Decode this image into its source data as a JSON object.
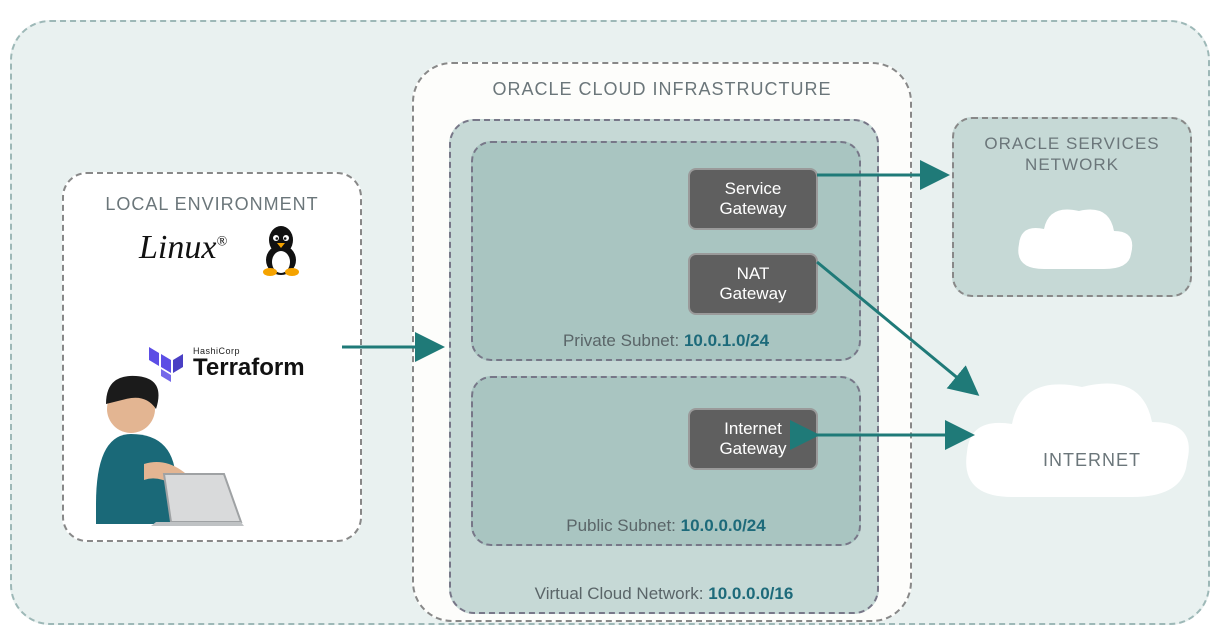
{
  "outer": {
    "title": ""
  },
  "local": {
    "title": "LOCAL ENVIRONMENT",
    "linux_label": "Linux",
    "linux_reg": "®",
    "terraform_vendor": "HashiCorp",
    "terraform_name": "Terraform"
  },
  "oci": {
    "title": "ORACLE CLOUD INFRASTRUCTURE",
    "vcn": {
      "label": "Virtual Cloud Network:",
      "cidr": "10.0.0.0/16",
      "private_subnet": {
        "label": "Private Subnet:",
        "cidr": "10.0.1.0/24",
        "service_gateway": "Service\nGateway",
        "nat_gateway": "NAT\nGateway"
      },
      "public_subnet": {
        "label": "Public Subnet:",
        "cidr": "10.0.0.0/24",
        "internet_gateway": "Internet\nGateway"
      }
    }
  },
  "osn": {
    "title": "ORACLE SERVICES NETWORK"
  },
  "internet": {
    "label": "INTERNET"
  },
  "colors": {
    "arrow": "#1f7a78",
    "box_fill": "#5f5f5f",
    "subnet_fill": "#a9c5c1"
  }
}
